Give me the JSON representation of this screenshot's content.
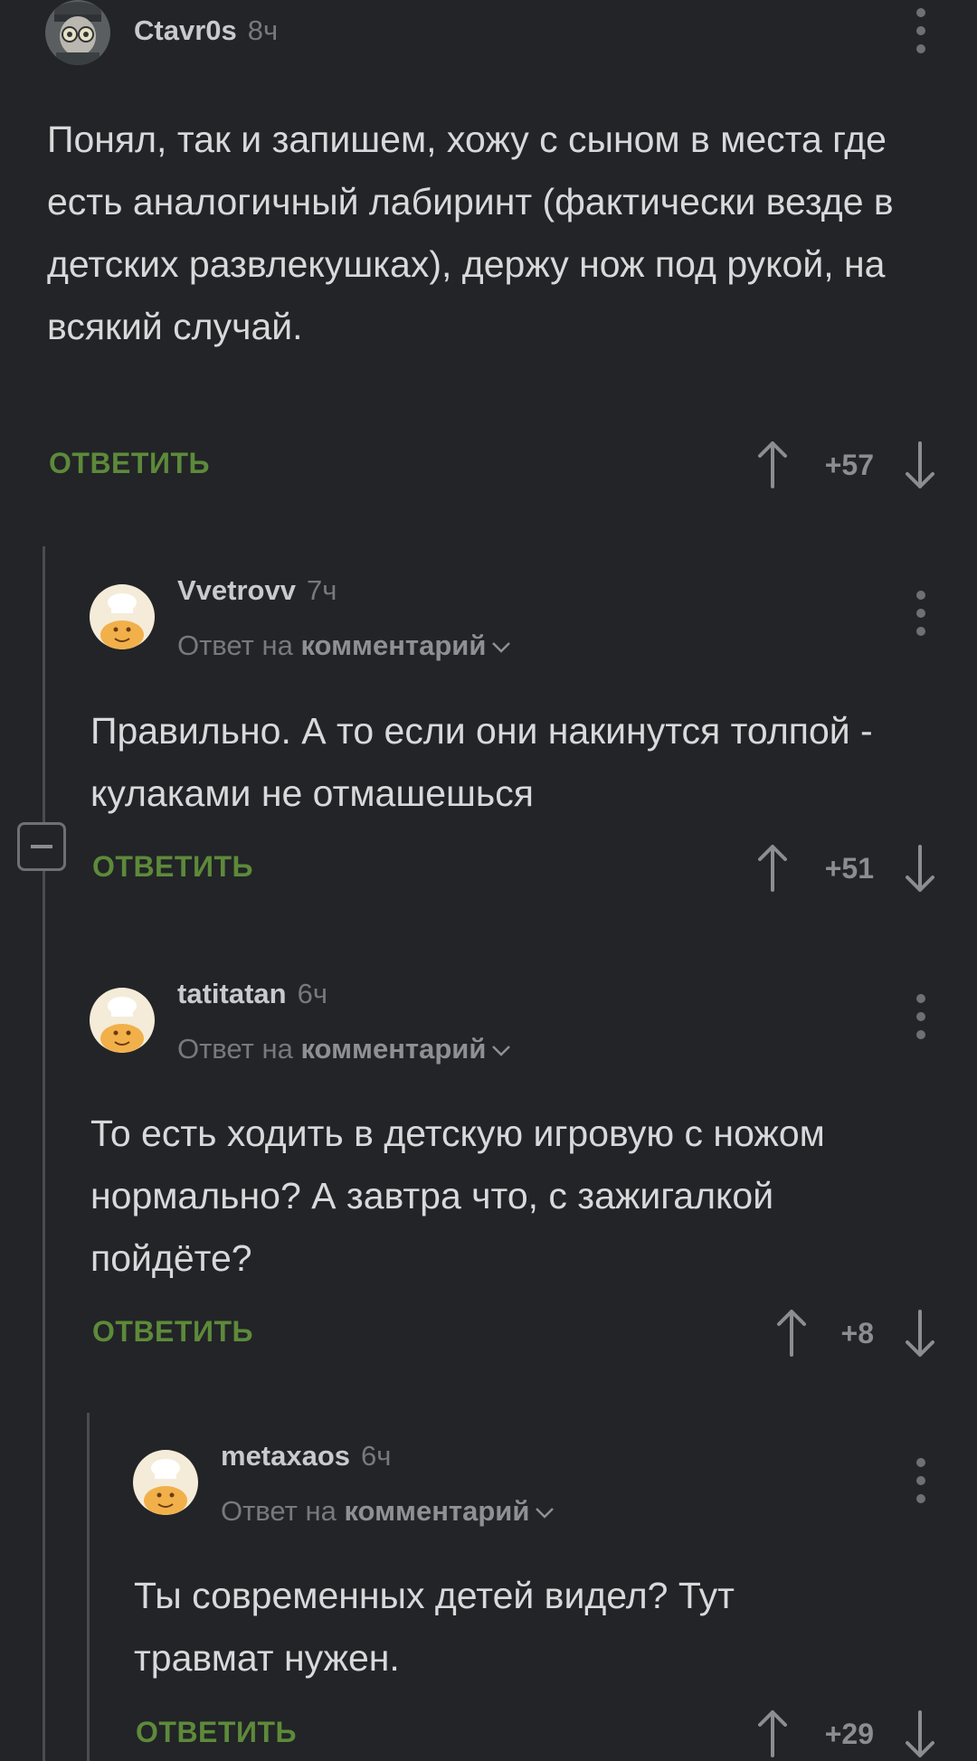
{
  "comments": [
    {
      "username": "Ctavr0s",
      "time": "8ч",
      "text": "Понял, так и запишем, хожу с сыном в места где есть аналогичный лабиринт (фактически везде в детских развлекушках), держу нож под рукой, на всякий случай.",
      "reply_label": "ОТВЕТИТЬ",
      "score": "+57",
      "avatar_icon": "user-avatar-icon"
    },
    {
      "username": "Vvetrovv",
      "time": "7ч",
      "reply_to_prefix": "Ответ на",
      "reply_to_target": "комментарий",
      "text": "Правильно. А то если они накинутся толпой - кулаками не отмашешься",
      "reply_label": "ОТВЕТИТЬ",
      "score": "+51",
      "avatar_icon": "chef-avatar-icon"
    },
    {
      "username": "tatitatan",
      "time": "6ч",
      "reply_to_prefix": "Ответ на",
      "reply_to_target": "комментарий",
      "text": "То есть ходить в детскую игровую с ножом нормально? А завтра что, с зажигалкой пойдёте?",
      "reply_label": "ОТВЕТИТЬ",
      "score": "+8",
      "avatar_icon": "chef-avatar-icon"
    },
    {
      "username": "metaxaos",
      "time": "6ч",
      "reply_to_prefix": "Ответ на",
      "reply_to_target": "комментарий",
      "text": "Ты современных детей видел? Тут травмат нужен.",
      "reply_label": "ОТВЕТИТЬ",
      "score": "+29",
      "avatar_icon": "chef-avatar-icon"
    }
  ],
  "colors": {
    "background": "#222427",
    "reply_green": "#5d8a3a",
    "text": "#d8d9da",
    "muted": "#77797c"
  }
}
